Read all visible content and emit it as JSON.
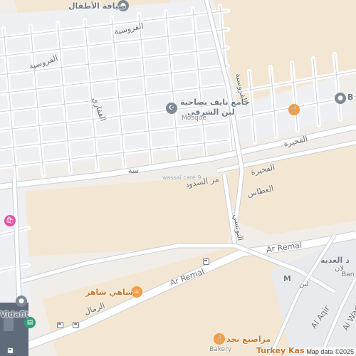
{
  "map": {
    "attribution": "Map data ©2025",
    "colors": {
      "land": "#f1eee9",
      "residential": "#eef0f3",
      "open_lot": "#f3e7d3",
      "road": "#ffffff",
      "road_edge": "#c9ced6",
      "orange_poi": "#f29d45",
      "green_poi": "#2f9e77",
      "gray_poi": "#7d8a96",
      "pink_poi": "#e052a0"
    },
    "pois": [
      {
        "name": "mosque",
        "icon": "mosque-icon",
        "line1": "جامع نايف بضاحية",
        "line2": "لبن الشرقي",
        "sub": "Mosque"
      },
      {
        "name": "food-place-east",
        "icon": "restaurant-icon",
        "label": "",
        "glyph": "🍴"
      },
      {
        "name": "shahi-shaher",
        "icon": "cafe-icon",
        "label": "شاهي شاهر"
      },
      {
        "name": "najd-bakery",
        "icon": "restaurant-icon",
        "label": "مراصيع نجد",
        "sub": "Bakery"
      },
      {
        "name": "turkey-kashta",
        "label": "Turkey Kashta"
      },
      {
        "name": "vidafit",
        "icon": "gym-icon",
        "label": "Vidafit"
      },
      {
        "name": "pink-shop",
        "icon": "shopping-icon",
        "label": ""
      },
      {
        "name": "masjid-label",
        "label": "M"
      },
      {
        "name": "north-place",
        "label": "ضيافة الأطفال"
      },
      {
        "name": "east-b",
        "label": "B"
      },
      {
        "name": "east-banner",
        "label": "Ban"
      },
      {
        "name": "al-adiya",
        "label": "د العدية"
      },
      {
        "name": "laan",
        "label": "لان"
      }
    ],
    "streets": {
      "ar_remal_1": "Ar Remal",
      "ar_remal_2": "Ar Remal",
      "ar_rimal_ar": "الرمال",
      "al_fursiya_1": "الفروسية",
      "al_fursiya_2": "الفروسية",
      "al_fursiya_3": "الفروسية",
      "al_faqari": "الفقاري",
      "al_fakhira_1": "الفخيرة",
      "al_fakhira_2": "الفخيرة",
      "al_attas": "العطاس",
      "al_soudus": "مر السدود",
      "al_tunisi": "التونسي",
      "al_aqir": "Al Aqir",
      "al_wadi": "Al Wadi",
      "misc_dark": "سة",
      "wassai_note": "wassai care 9",
      "east_street": "لبن"
    }
  }
}
